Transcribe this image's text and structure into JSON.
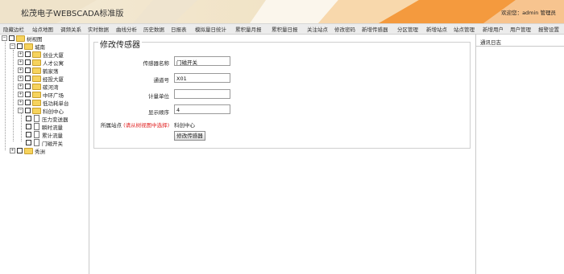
{
  "header": {
    "title": "松茂电子WEBSCADA标准版",
    "welcome": "欢迎您：admin 管理员"
  },
  "nav": {
    "items": [
      "隐藏边栏",
      "站点地图",
      "调频关系",
      "实时数据",
      "曲线分析",
      "历史数据",
      "日报表",
      "模拟量日统计",
      "累积量月报",
      "累积量日报",
      "关注站点",
      "修改密码",
      "新增传感器",
      "分区管理",
      "新增站点",
      "站点管理",
      "新增用户",
      "用户管理",
      "报警设置"
    ]
  },
  "tree": {
    "root": "树视图",
    "city": "城南",
    "folders": [
      "创业大厦",
      "人才公寓",
      "鹤家荡",
      "经投大厦",
      "碳河湾",
      "中环广场",
      "低功耗单台"
    ],
    "open_folder": "科创中心",
    "sensors": [
      "压力变送器",
      "瞬时流量",
      "累计流量",
      "门磁开关"
    ],
    "other": "秀洲"
  },
  "form": {
    "legend": "修改传感器",
    "fields": [
      {
        "label": "传感器名称",
        "value": "门磁开关"
      },
      {
        "label": "通道号",
        "value": "X01"
      },
      {
        "label": "计量单位",
        "value": ""
      },
      {
        "label": "显示顺序",
        "value": "4"
      }
    ],
    "station_label": "所属站点",
    "station_hint": "(请从树视图中选择)",
    "station_value": "科创中心",
    "submit": "修改传感器"
  },
  "log": {
    "title": "通讯日志"
  }
}
